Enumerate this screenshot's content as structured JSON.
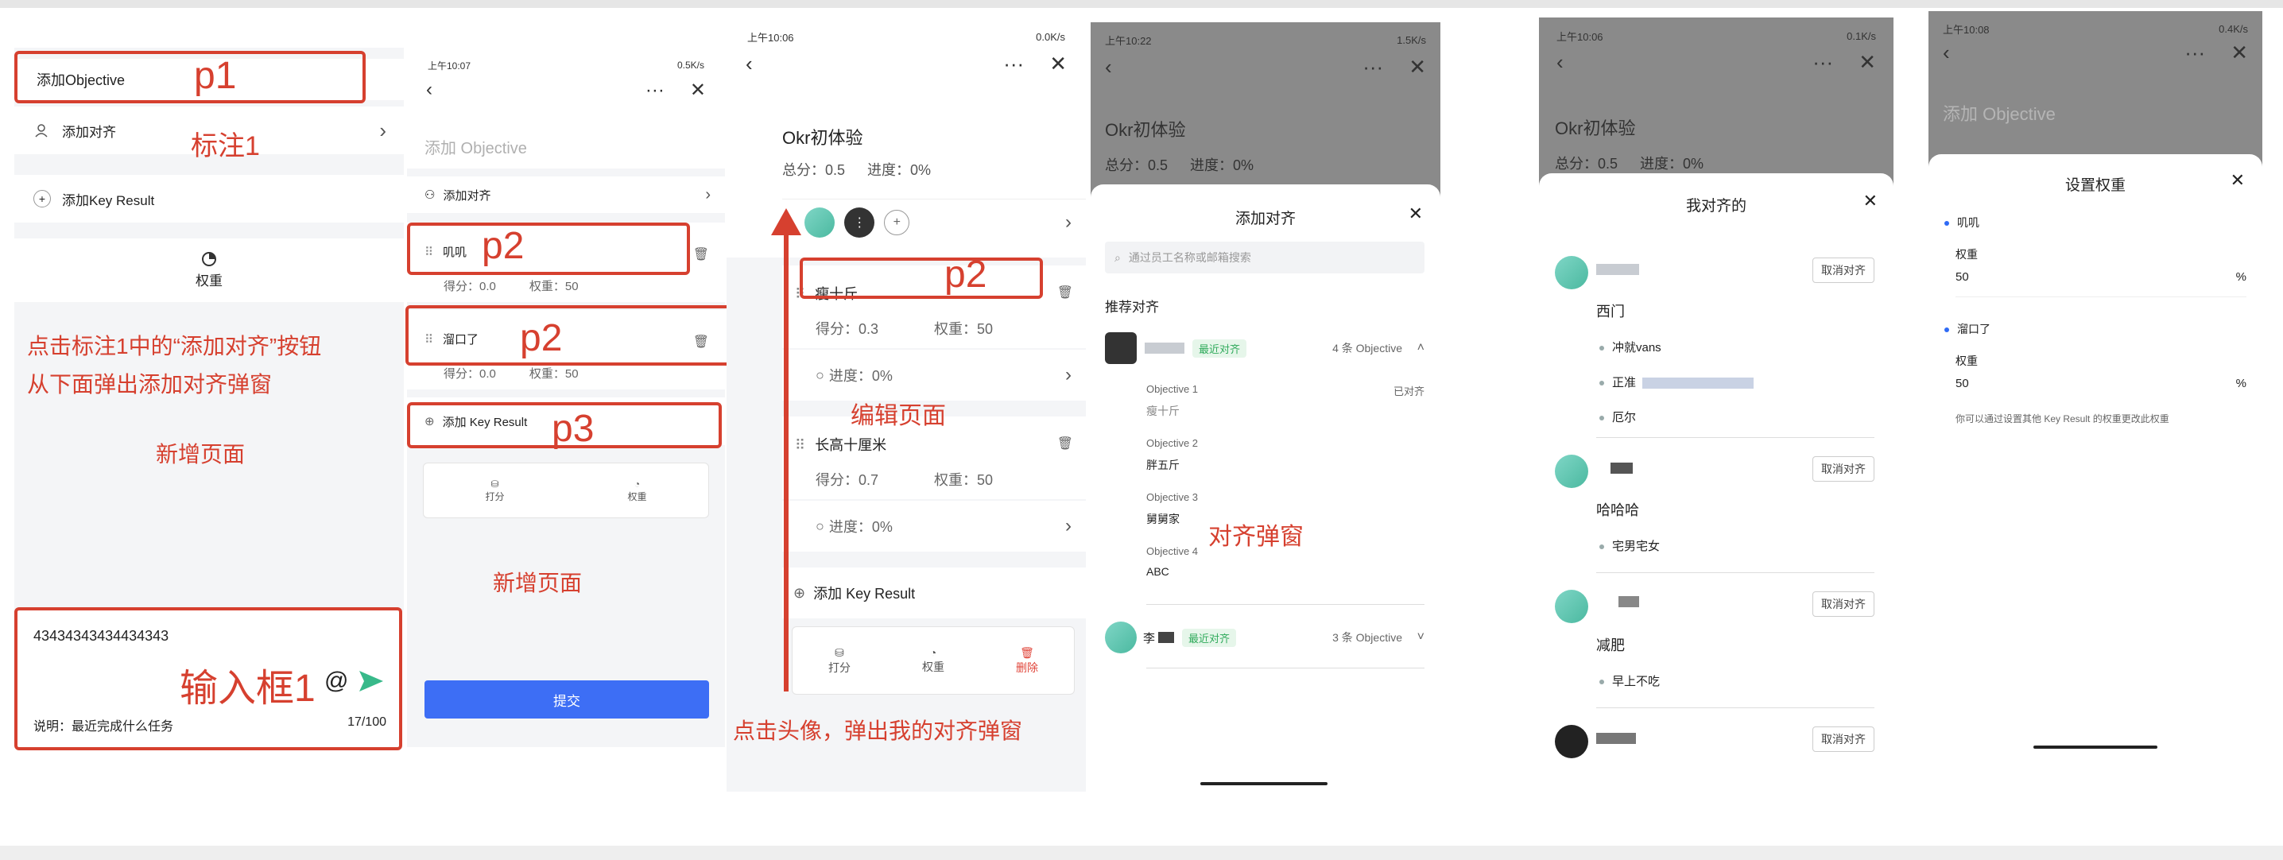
{
  "annotations": {
    "p1": "p1",
    "p2": "p2",
    "p3": "p3",
    "mark1": "标注1",
    "input1": "输入框1",
    "desc_add_align": "点击标注1中的“添加对齐”按钮",
    "desc_add_align2": "从下面弹出添加对齐弹窗",
    "new_page": "新增页面",
    "new_page2": "新增页面",
    "edit_page": "编辑页面",
    "align_popup": "对齐弹窗",
    "click_avatar": "点击头像，弹出我的对齐弹窗"
  },
  "screen1": {
    "objective_placeholder": "添加Objective",
    "add_align": "添加对齐",
    "add_kr": "添加Key Result",
    "weight": "权重",
    "input_value": "43434343434434343",
    "desc": "说明：最近完成什么任务",
    "count": "17/100",
    "at": "@"
  },
  "screen2": {
    "status_time": "上午10:07",
    "status_right": "0.5K/s",
    "title_placeholder": "添加 Objective",
    "add_align": "添加对齐",
    "kr1_name": "叽叽",
    "kr1_score": "得分：0.0",
    "kr1_weight": "权重：50",
    "kr2_name": "溜口了",
    "kr2_score": "得分：0.0",
    "kr2_weight": "权重：50",
    "add_kr": "添加 Key Result",
    "tool_score": "打分",
    "tool_weight": "权重",
    "submit": "提交"
  },
  "screen3": {
    "status_time": "上午10:06",
    "status_right": "0.0K/s",
    "title": "Okr初体验",
    "total_score": "总分：0.5",
    "progress": "进度：0%",
    "kr1_name": "瘦十斤",
    "kr1_score": "得分：0.3",
    "kr1_weight": "权重：50",
    "kr1_progress": "进度：0%",
    "kr2_name": "长高十厘米",
    "kr2_score": "得分：0.7",
    "kr2_weight": "权重：50",
    "kr2_progress": "进度：0%",
    "add_kr": "添加 Key Result",
    "tool_score": "打分",
    "tool_weight": "权重",
    "tool_delete": "删除"
  },
  "screen4": {
    "status_time": "上午10:22",
    "status_right": "1.5K/s",
    "title": "Okr初体验",
    "total_score": "总分：0.5",
    "progress": "进度：0%",
    "sheet_title": "添加对齐",
    "search_placeholder": "通过员工名称或邮箱搜索",
    "recommend": "推荐对齐",
    "recent_tag": "最近对齐",
    "count1": "4 条 Objective",
    "obj1_label": "Objective 1",
    "obj1_value": "瘦十斤",
    "obj1_state": "已对齐",
    "obj2_label": "Objective 2",
    "obj2_value": "胖五斤",
    "obj3_label": "Objective 3",
    "obj3_value": "舅舅家",
    "obj4_label": "Objective 4",
    "obj4_value": "ABC",
    "user2_name": "李",
    "recent_tag2": "最近对齐",
    "count2": "3 条 Objective"
  },
  "screen5": {
    "status_time": "上午10:06",
    "status_right": "0.1K/s",
    "title": "Okr初体验",
    "total_score": "总分：0.5",
    "progress": "进度：0%",
    "sheet_title": "我对齐的",
    "cancel": "取消对齐",
    "g1_title": "西门",
    "g1_items": [
      "冲就vans",
      "正准",
      "厄尔"
    ],
    "g2_title": "哈哈哈",
    "g2_items": [
      "宅男宅女"
    ],
    "g3_title": "减肥",
    "g3_items": [
      "早上不吃"
    ]
  },
  "screen6": {
    "status_time": "上午10:08",
    "status_right": "0.4K/s",
    "title_placeholder": "添加 Objective",
    "sheet_title": "设置权重",
    "kr1_name": "叽叽",
    "weight_label": "权重",
    "kr1_value": "50",
    "kr2_name": "溜口了",
    "kr2_value": "50",
    "percent": "%",
    "hint": "你可以通过设置其他 Key Result 的权重更改此权重"
  },
  "colors": {
    "annotation_red": "#d6402f",
    "primary_blue": "#3d6ef5",
    "tag_green": "#2faa5b",
    "delete_red": "#e0453a"
  }
}
